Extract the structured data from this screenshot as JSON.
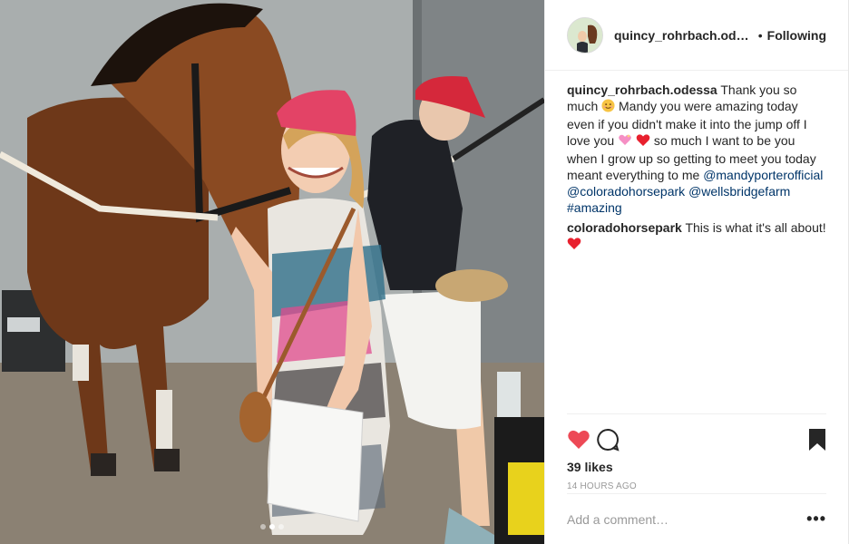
{
  "header": {
    "username": "quincy_rohrbach.ode...",
    "separator": "•",
    "follow_status": "Following"
  },
  "comments": [
    {
      "user": "quincy_rohrbach.odessa",
      "text_1": "Thank you so much",
      "text_2": "Mandy you were amazing today even if you didn't make it into the jump off I love you",
      "text_3": "so much I want to be you when I grow up so getting to meet you today meant everything to me",
      "mentions": [
        "@mandyporterofficial",
        "@coloradohorsepark",
        "@wellsbridgefarm",
        "#amazing"
      ]
    },
    {
      "user": "coloradohorsepark",
      "text": "This is what it's all about!"
    }
  ],
  "likes": "39 likes",
  "timestamp": "14 HOURS AGO",
  "add_comment": {
    "placeholder": "Add a comment…"
  },
  "more_label": "•••",
  "icons": {
    "like": "heart-icon",
    "comment": "comment-icon",
    "save": "bookmark-icon"
  },
  "colors": {
    "like": "#ed4956",
    "link": "#003569",
    "muted": "#999999"
  },
  "carousel": {
    "count": 3,
    "active": 1
  }
}
